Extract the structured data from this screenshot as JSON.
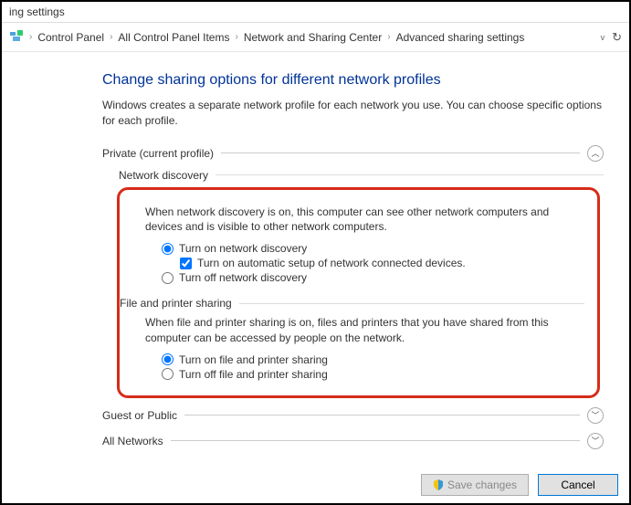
{
  "titlebar": "ing settings",
  "breadcrumb": {
    "items": [
      "Control Panel",
      "All Control Panel Items",
      "Network and Sharing Center",
      "Advanced sharing settings"
    ]
  },
  "page": {
    "title": "Change sharing options for different network profiles",
    "subtitle": "Windows creates a separate network profile for each network you use. You can choose specific options for each profile."
  },
  "sections": {
    "private": {
      "label": "Private (current profile)",
      "network_discovery": {
        "header": "Network discovery",
        "desc": "When network discovery is on, this computer can see other network computers and devices and is visible to other network computers.",
        "opt_on": "Turn on network discovery",
        "opt_auto": "Turn on automatic setup of network connected devices.",
        "opt_off": "Turn off network discovery"
      },
      "file_printer": {
        "header": "File and printer sharing",
        "desc": "When file and printer sharing is on, files and printers that you have shared from this computer can be accessed by people on the network.",
        "opt_on": "Turn on file and printer sharing",
        "opt_off": "Turn off file and printer sharing"
      }
    },
    "guest": {
      "label": "Guest or Public"
    },
    "all": {
      "label": "All Networks"
    }
  },
  "footer": {
    "save": "Save changes",
    "cancel": "Cancel"
  }
}
